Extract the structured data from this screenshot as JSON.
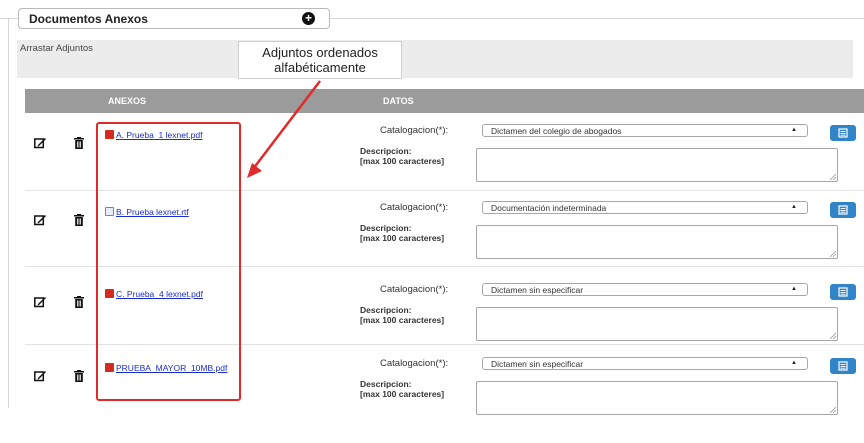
{
  "section": {
    "title": "Documentos Anexos",
    "add_label": "+"
  },
  "dropzone": {
    "label": "Arrastar Adjuntos"
  },
  "table": {
    "col_anexos": "ANEXOS",
    "col_datos": "DATOS"
  },
  "labels": {
    "catalogacion": "Catalogacion(*):",
    "descripcion": "Descripcion:",
    "max_chars": "[max 100 caracteres]"
  },
  "rows": [
    {
      "file": "A. Prueba_1 lexnet.pdf",
      "file_type": "pdf-icon",
      "category": "Dictamen del colegio de abogados"
    },
    {
      "file": "B. Prueba lexnet.rtf",
      "file_type": "rtf-icon",
      "category": "Documentación indeterminada"
    },
    {
      "file": "C. Prueba_4 lexnet.pdf",
      "file_type": "pdf-icon",
      "category": "Dictamen sin especificar"
    },
    {
      "file": "PRUEBA_MAYOR_10MB.pdf",
      "file_type": "pdf-icon",
      "category": "Dictamen sin especificar"
    }
  ],
  "annotation": {
    "line1": "Adjuntos ordenados",
    "line2": "alfabéticamente"
  },
  "colors": {
    "header": "#9b9b9b",
    "highlight": "#e12a2a",
    "button": "#3184c7",
    "link": "#1a2ccf"
  },
  "icons": [
    "edit-icon",
    "trash-icon",
    "pdf-icon",
    "rtf-icon",
    "list-icon",
    "plus-circle-icon",
    "caret-up-icon"
  ]
}
